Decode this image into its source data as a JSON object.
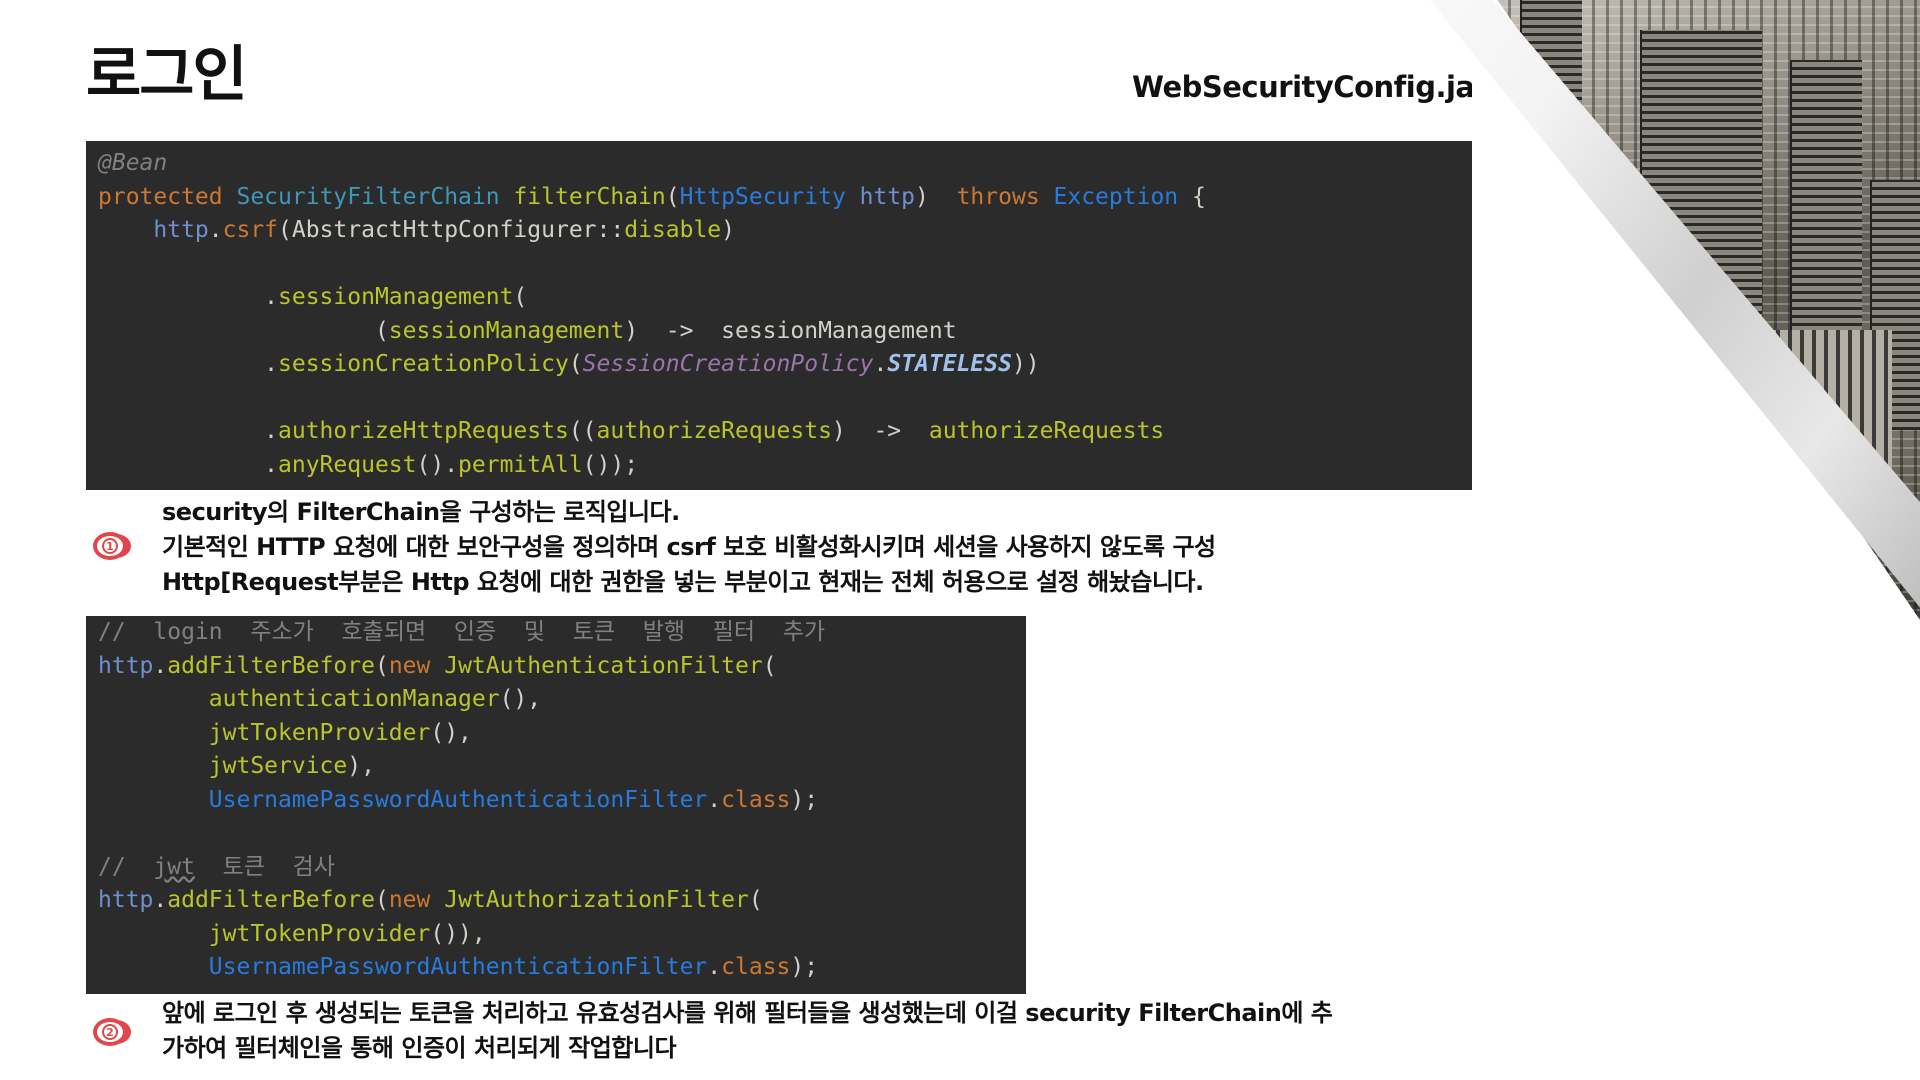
{
  "page": {
    "title": "로그인",
    "filename": "WebSecurityConfig.java"
  },
  "code_block_1": {
    "lines": [
      [
        {
          "t": "@Bean",
          "c": "ann"
        }
      ],
      [
        {
          "t": "protected ",
          "c": "kw"
        },
        {
          "t": "SecurityFilterChain ",
          "c": "teal"
        },
        {
          "t": "filterChain",
          "c": "fn"
        },
        {
          "t": "(",
          "c": "par"
        },
        {
          "t": "HttpSecurity ",
          "c": "cls"
        },
        {
          "t": "http",
          "c": "var"
        },
        {
          "t": ")  ",
          "c": "par"
        },
        {
          "t": "throws ",
          "c": "kw"
        },
        {
          "t": "Exception ",
          "c": "cls"
        },
        {
          "t": "{",
          "c": "par"
        }
      ],
      [
        {
          "t": "    http",
          "c": "var"
        },
        {
          "t": ".",
          "c": "par"
        },
        {
          "t": "csrf",
          "c": "kw"
        },
        {
          "t": "(AbstractHttpConfigurer::",
          "c": "par"
        },
        {
          "t": "disable",
          "c": "fn"
        },
        {
          "t": ")",
          "c": "par"
        }
      ],
      [
        {
          "t": "",
          "c": "par"
        }
      ],
      [
        {
          "t": "            .",
          "c": "par"
        },
        {
          "t": "sessionManagement",
          "c": "fn"
        },
        {
          "t": "(",
          "c": "par"
        }
      ],
      [
        {
          "t": "                    (",
          "c": "par"
        },
        {
          "t": "sessionManagement",
          "c": "fn"
        },
        {
          "t": ")  ->  sessionManagement",
          "c": "par"
        }
      ],
      [
        {
          "t": "            .",
          "c": "par"
        },
        {
          "t": "sessionCreationPolicy",
          "c": "fn"
        },
        {
          "t": "(",
          "c": "par"
        },
        {
          "t": "SessionCreationPolicy",
          "c": "enumc"
        },
        {
          "t": ".",
          "c": "par"
        },
        {
          "t": "STATELESS",
          "c": "enumv"
        },
        {
          "t": "))",
          "c": "par"
        }
      ],
      [
        {
          "t": "",
          "c": "par"
        }
      ],
      [
        {
          "t": "            .",
          "c": "par"
        },
        {
          "t": "authorizeHttpRequests",
          "c": "fn"
        },
        {
          "t": "((",
          "c": "par"
        },
        {
          "t": "authorizeRequests",
          "c": "fn"
        },
        {
          "t": ")  ->  ",
          "c": "par"
        },
        {
          "t": "authorizeRequests",
          "c": "fn"
        }
      ],
      [
        {
          "t": "            .",
          "c": "par"
        },
        {
          "t": "anyRequest",
          "c": "fn"
        },
        {
          "t": "().",
          "c": "par"
        },
        {
          "t": "permitAll",
          "c": "fn"
        },
        {
          "t": "());",
          "c": "par"
        }
      ]
    ]
  },
  "description_1": {
    "badge": "1",
    "lines": [
      "security의 FilterChain을 구성하는 로직입니다.",
      "기본적인 HTTP 요청에 대한 보안구성을 정의하며 csrf 보호 비활성화시키며 세션을 사용하지 않도록 구성",
      "Http[Request부분은 Http 요청에 대한 권한을 넣는 부분이고 현재는 전체 허용으로 설정 해놨습니다."
    ]
  },
  "code_block_2": {
    "lines": [
      [
        {
          "t": "//  login  주소가  호출되면  인증  및  토큰  발행  필터  추가",
          "c": "cmt"
        }
      ],
      [
        {
          "t": "http",
          "c": "var"
        },
        {
          "t": ".",
          "c": "par"
        },
        {
          "t": "addFilterBefore",
          "c": "fn"
        },
        {
          "t": "(",
          "c": "par"
        },
        {
          "t": "new ",
          "c": "kw"
        },
        {
          "t": "JwtAuthenticationFilter",
          "c": "fn"
        },
        {
          "t": "(",
          "c": "par"
        }
      ],
      [
        {
          "t": "        ",
          "c": "par"
        },
        {
          "t": "authenticationManager",
          "c": "fn"
        },
        {
          "t": "(),",
          "c": "par"
        }
      ],
      [
        {
          "t": "        ",
          "c": "par"
        },
        {
          "t": "jwtTokenProvider",
          "c": "fn"
        },
        {
          "t": "(),",
          "c": "par"
        }
      ],
      [
        {
          "t": "        ",
          "c": "par"
        },
        {
          "t": "jwtService",
          "c": "fn"
        },
        {
          "t": "),",
          "c": "par"
        }
      ],
      [
        {
          "t": "        ",
          "c": "par"
        },
        {
          "t": "UsernamePasswordAuthenticationFilter",
          "c": "cls"
        },
        {
          "t": ".",
          "c": "par"
        },
        {
          "t": "class",
          "c": "kw"
        },
        {
          "t": ");",
          "c": "par"
        }
      ],
      [
        {
          "t": "",
          "c": "par"
        }
      ],
      [
        {
          "t": "//  ",
          "c": "cmt"
        },
        {
          "t": "jwt",
          "c": "cmt jwt"
        },
        {
          "t": "  토큰  검사",
          "c": "cmt"
        }
      ],
      [
        {
          "t": "http",
          "c": "var"
        },
        {
          "t": ".",
          "c": "par"
        },
        {
          "t": "addFilterBefore",
          "c": "fn"
        },
        {
          "t": "(",
          "c": "par"
        },
        {
          "t": "new ",
          "c": "kw"
        },
        {
          "t": "JwtAuthorizationFilter",
          "c": "fn"
        },
        {
          "t": "(",
          "c": "par"
        }
      ],
      [
        {
          "t": "        ",
          "c": "par"
        },
        {
          "t": "jwtTokenProvider",
          "c": "fn"
        },
        {
          "t": "()),",
          "c": "par"
        }
      ],
      [
        {
          "t": "        ",
          "c": "par"
        },
        {
          "t": "UsernamePasswordAuthenticationFilter",
          "c": "cls"
        },
        {
          "t": ".",
          "c": "par"
        },
        {
          "t": "class",
          "c": "kw"
        },
        {
          "t": ");",
          "c": "par"
        }
      ]
    ]
  },
  "description_2": {
    "badge": "2",
    "lines": [
      "앞에 로그인 후 생성되는 토큰을 처리하고 유효성검사를 위해 필터들을 생성했는데 이걸  security FilterChain에 추",
      "가하여 필터체인을 통해 인증이 처리되게 작업합니다"
    ]
  }
}
